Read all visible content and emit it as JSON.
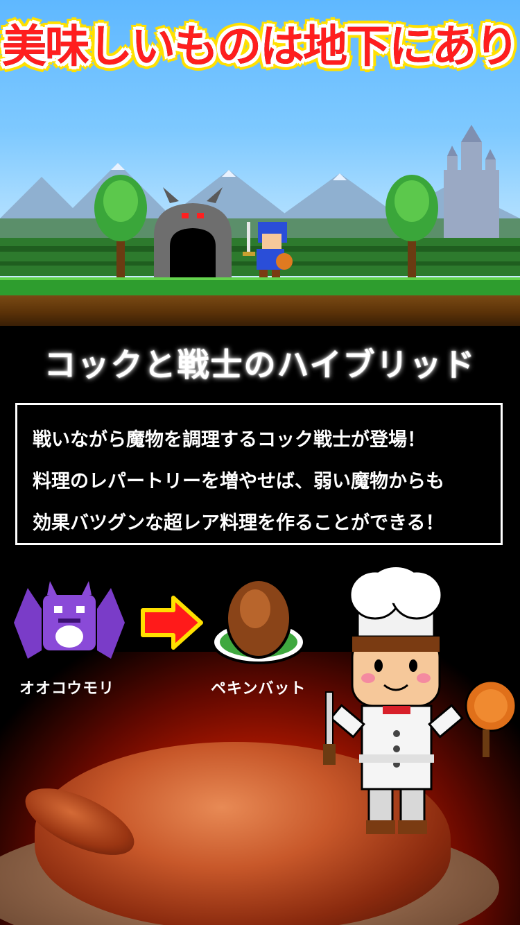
{
  "header": {
    "title": "美味しいものは地下にあり"
  },
  "subtitle": "コックと戦士のハイブリッド",
  "description": {
    "lines": [
      "戦いながら魔物を調理するコック戦士が登場！",
      "料理のレパートリーを増やせば、弱い魔物からも",
      "効果バツグンな超レア料理を作ることができる！"
    ]
  },
  "transform": {
    "monster_label": "オオコウモリ",
    "dish_label": "ペキンバット"
  },
  "icons": {
    "monster": "bat-monster-icon",
    "arrow": "arrow-right-icon",
    "dish": "roast-dish-icon",
    "chef": "chef-character"
  },
  "colors": {
    "title_red": "#ff1e1e",
    "title_yellow": "#ffe000",
    "sky": "#7ec9ff",
    "grass": "#2e9d2e",
    "arrow_red": "#ff1a1a",
    "bat_purple": "#7a3cc8"
  }
}
